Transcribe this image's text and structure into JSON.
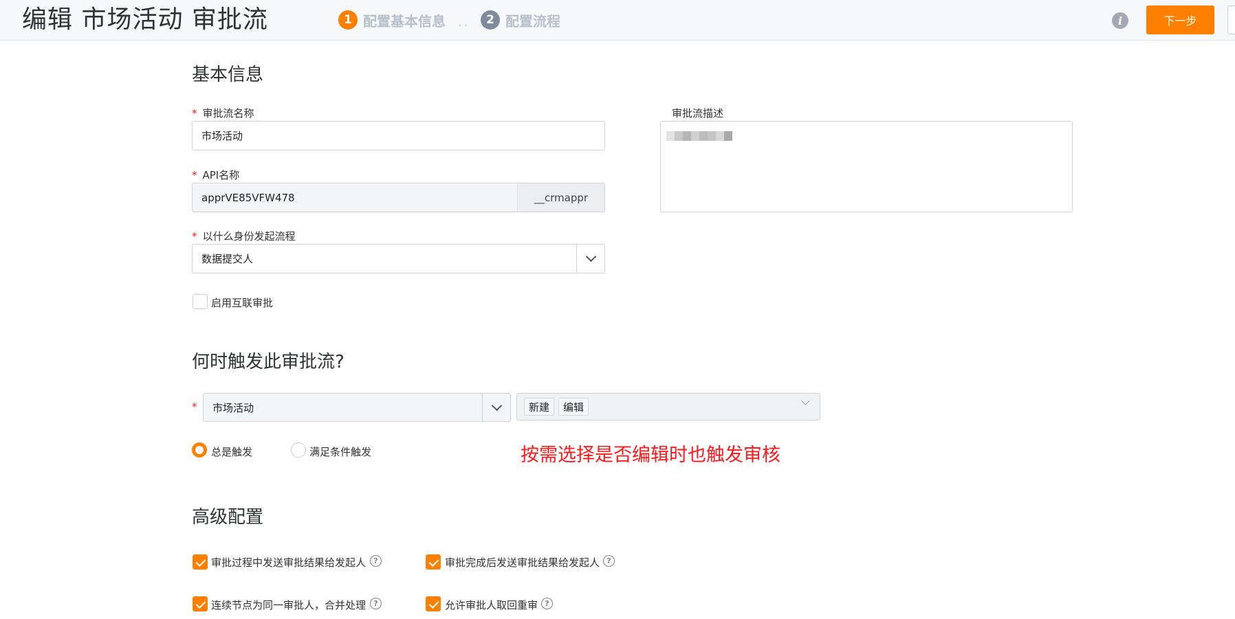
{
  "header": {
    "title": "编辑 市场活动 审批流",
    "steps": [
      {
        "num": "1",
        "label": "配置基本信息",
        "color": "#ff8000"
      },
      {
        "num": "2",
        "label": "配置流程",
        "color": "#7f8b9c"
      }
    ],
    "dots": "..",
    "info_icon": "i",
    "next_label": "下一步"
  },
  "basic": {
    "title": "基本信息",
    "required_mark": "*",
    "name_label": "审批流名称",
    "name_value": "市场活动",
    "api_label": "API名称",
    "api_value": "apprVE85VFW478",
    "api_suffix": "__crmappr",
    "initiator_label": "以什么身份发起流程",
    "initiator_value": "数据提交人",
    "desc_label": "审批流描述",
    "interconnect_label": "启用互联审批"
  },
  "trigger": {
    "title": "何时触发此审批流?",
    "object_value": "市场活动",
    "tags": [
      "新建",
      "编辑"
    ],
    "radio_always": "总是触发",
    "radio_condition": "满足条件触发",
    "annotation": "按需选择是否编辑时也触发审核"
  },
  "advanced": {
    "title": "高级配置",
    "options": [
      "审批过程中发送审批结果给发起人",
      "审批完成后发送审批结果给发起人",
      "连续节点为同一审批人，合并处理",
      "允许审批人取回重审"
    ],
    "help_glyph": "?"
  },
  "colors": {
    "accent": "#ff8000",
    "annotation": "#ff1a1a",
    "required": "#f5222d"
  }
}
